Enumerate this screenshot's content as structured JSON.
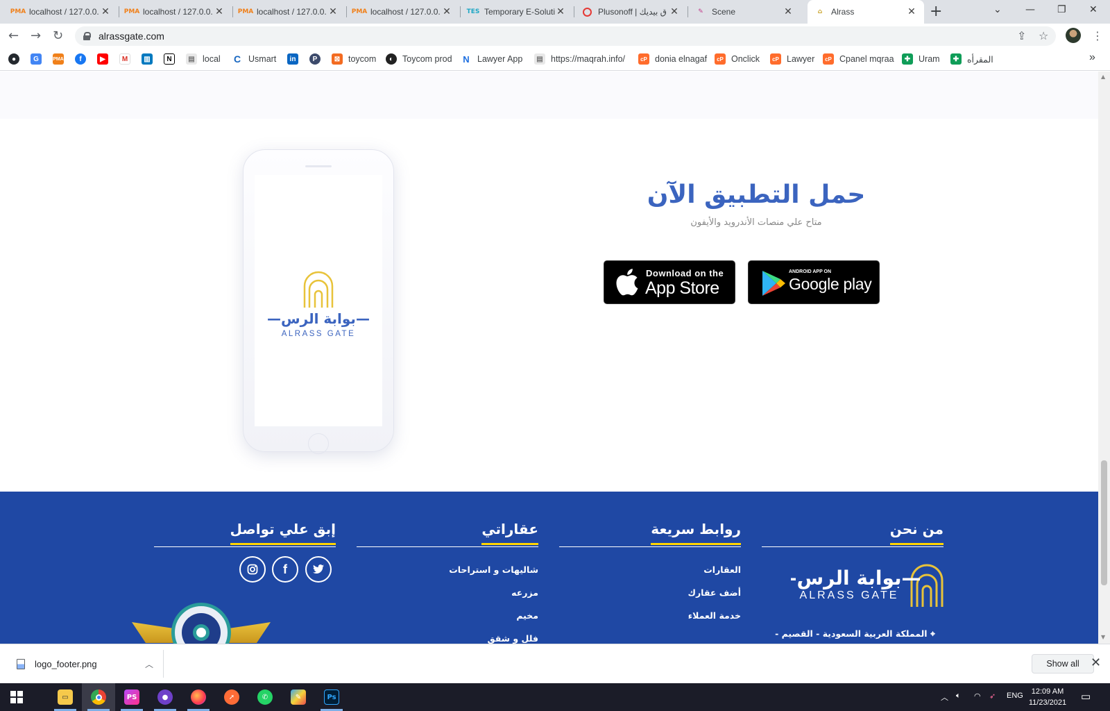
{
  "browser": {
    "tabs": [
      {
        "title": "localhost / 127.0.0.",
        "icon": "phpmyadmin-icon"
      },
      {
        "title": "localhost / 127.0.0.",
        "icon": "phpmyadmin-icon"
      },
      {
        "title": "localhost / 127.0.0.",
        "icon": "phpmyadmin-icon"
      },
      {
        "title": "localhost / 127.0.0.",
        "icon": "phpmyadmin-icon"
      },
      {
        "title": "Temporary E-Soluti",
        "icon": "tes-icon"
      },
      {
        "title": "Plusonoff | ق بيديك",
        "icon": "target-icon"
      },
      {
        "title": "Scene",
        "icon": "scene-icon"
      },
      {
        "title": "Alrass",
        "icon": "alrass-icon"
      }
    ],
    "active_tab_index": 7,
    "url": "alrassgate.com",
    "bookmarks": [
      {
        "label": "",
        "icon": "github-icon"
      },
      {
        "label": "",
        "icon": "google-translate-icon"
      },
      {
        "label": "",
        "icon": "phpmyadmin-icon"
      },
      {
        "label": "",
        "icon": "facebook-icon"
      },
      {
        "label": "",
        "icon": "youtube-icon"
      },
      {
        "label": "",
        "icon": "gmail-icon"
      },
      {
        "label": "",
        "icon": "trello-icon"
      },
      {
        "label": "",
        "icon": "notion-icon"
      },
      {
        "label": "local",
        "icon": "folder-icon"
      },
      {
        "label": "Usmart",
        "icon": "usmart-icon"
      },
      {
        "label": "",
        "icon": "linkedin-icon"
      },
      {
        "label": "",
        "icon": "p-icon"
      },
      {
        "label": "toycom",
        "icon": "toycom-icon"
      },
      {
        "label": "Toycom prod",
        "icon": "globe-icon"
      },
      {
        "label": "Lawyer App",
        "icon": "n-icon"
      },
      {
        "label": "https://maqrah.info/",
        "icon": "folder-icon"
      },
      {
        "label": "donia elnagaf",
        "icon": "cpanel-icon"
      },
      {
        "label": "Onclick",
        "icon": "cpanel-icon"
      },
      {
        "label": "Lawyer",
        "icon": "cpanel-icon"
      },
      {
        "label": "Cpanel mqraa",
        "icon": "cpanel-icon"
      },
      {
        "label": "Uram",
        "icon": "sheets-icon"
      },
      {
        "label": "المقرأه",
        "icon": "sheets-icon"
      }
    ]
  },
  "app_section": {
    "title": "حمل التطبيق الآن",
    "subtitle": "متاح علي منصات الأندرويد والأيفون",
    "appstore": {
      "small": "Download on the",
      "big": "App Store"
    },
    "googleplay": {
      "small": "ANDROID APP ON",
      "big": "Google play"
    },
    "phone_logo": {
      "arabic": "بوابة الرس",
      "latin": "ALRASS GATE"
    }
  },
  "footer": {
    "about": {
      "heading": "من نحن",
      "logo_arabic": "بوابة الرس",
      "logo_latin": "ALRASS GATE",
      "address": "المملكة العربية السعودية - القصيم -"
    },
    "quick_links": {
      "heading": "روابط سريعة",
      "items": [
        "العقارات",
        "أضف عقارك",
        "خدمة العملاء"
      ]
    },
    "my_properties": {
      "heading": "عقاراتي",
      "items": [
        "شاليهات و استراحات",
        "مزرعه",
        "مخيم",
        "فلل و شقق"
      ]
    },
    "contact": {
      "heading": "إبق علي تواصل",
      "social": [
        "instagram-icon",
        "facebook-icon",
        "twitter-icon"
      ]
    },
    "colors": {
      "background": "#1f48a4",
      "accent": "#ffd400",
      "title_blue": "#3b64bf"
    }
  },
  "downloads": {
    "file": "logo_footer.png",
    "show_all": "Show all"
  },
  "taskbar": {
    "apps": [
      "windows-start-icon",
      "file-explorer-icon",
      "chrome-icon",
      "phpstorm-icon",
      "github-desktop-icon",
      "firefox-icon",
      "postman-icon",
      "whatsapp-icon",
      "paint-icon",
      "photoshop-icon"
    ],
    "language": "ENG",
    "time": "12:09 AM",
    "date": "11/23/2021"
  }
}
